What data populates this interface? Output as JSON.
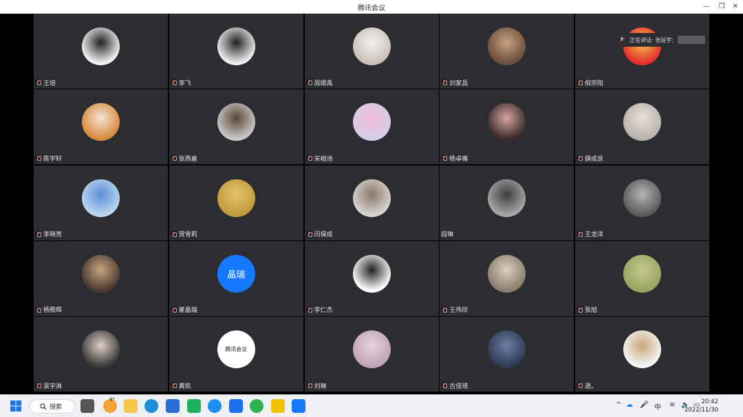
{
  "window": {
    "title": "腾讯会议"
  },
  "speaking": {
    "label": "正在讲话: 张延宇;"
  },
  "participants": [
    {
      "name": "王培",
      "avatar": "#f4f4f4",
      "accent": "#222"
    },
    {
      "name": "李飞",
      "avatar": "#f0f0f0",
      "accent": "#222"
    },
    {
      "name": "周顺禹",
      "avatar": "#c9c1b8",
      "accent": "#f2f2f2"
    },
    {
      "name": "刘家昌",
      "avatar": "#6b4e3d",
      "accent": "#c9a27e"
    },
    {
      "name": "倪宗阳",
      "avatar": "#e62e2e",
      "accent": "#f3c64b"
    },
    {
      "name": "陈宇轩",
      "avatar": "#d98a3d",
      "accent": "#f3e4d4"
    },
    {
      "name": "张燕嘉",
      "avatar": "#c9c9c9",
      "accent": "#5a4535"
    },
    {
      "name": "宋相池",
      "avatar": "#d6cde6",
      "accent": "#f1bcd7"
    },
    {
      "name": "杨卓骞",
      "avatar": "#3a2d2a",
      "accent": "#d7a6a0"
    },
    {
      "name": "薛成良",
      "avatar": "#b9b3ae",
      "accent": "#e8dfd7"
    },
    {
      "name": "李晓亮",
      "avatar": "#bcd5ef",
      "accent": "#5c8fd6"
    },
    {
      "name": "贺雪莉",
      "avatar": "#c29a3e",
      "accent": "#e3c46a"
    },
    {
      "name": "闫保成",
      "avatar": "#d8d5d2",
      "accent": "#8a7766"
    },
    {
      "name": "段琳",
      "avatar": "#a7a7a7",
      "accent": "#3d3d3d"
    },
    {
      "name": "王龙洋",
      "avatar": "#5a5a5a",
      "accent": "#b5b5b5"
    },
    {
      "name": "杨腾辉",
      "avatar": "#4a3a30",
      "accent": "#caa480"
    },
    {
      "name": "蒙晶瑞",
      "avatar": "#1677ff",
      "accent": "#1677ff",
      "text": "晶瑞"
    },
    {
      "name": "李仁杰",
      "avatar": "#ffffff",
      "accent": "#222"
    },
    {
      "name": "王伟欣",
      "avatar": "#8b7d6d",
      "accent": "#ddd0c0"
    },
    {
      "name": "张旭",
      "avatar": "#96a65f",
      "accent": "#c7c790"
    },
    {
      "name": "吴宇淋",
      "avatar": "#3b3b3b",
      "accent": "#e0cfc4"
    },
    {
      "name": "黄凯",
      "avatar": "#ffffff",
      "accent": "#1677ff",
      "text": "腾讯会议"
    },
    {
      "name": "刘琳",
      "avatar": "#c0a4b7",
      "accent": "#e6d5dd"
    },
    {
      "name": "古佳琦",
      "avatar": "#2d3a52",
      "accent": "#6c7fa6"
    },
    {
      "name": "退。",
      "avatar": "#f5f5f5",
      "accent": "#caa67a"
    }
  ],
  "taskbar": {
    "search_label": "搜索",
    "badge": "9°",
    "ime": "中",
    "time": "20:42",
    "date": "2022/11/30"
  }
}
